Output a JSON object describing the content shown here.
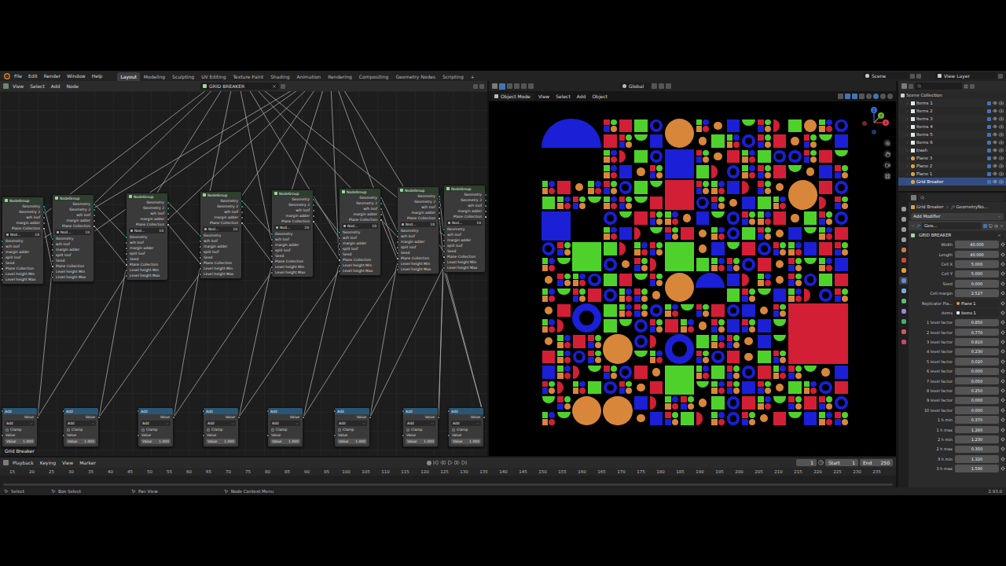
{
  "top_bar": {
    "menus": [
      "File",
      "Edit",
      "Render",
      "Window",
      "Help"
    ],
    "workspaces": [
      {
        "label": "Layout",
        "selected": true
      },
      {
        "label": "Modeling",
        "selected": false
      },
      {
        "label": "Sculpting",
        "selected": false
      },
      {
        "label": "UV Editing",
        "selected": false
      },
      {
        "label": "Texture Paint",
        "selected": false
      },
      {
        "label": "Shading",
        "selected": false
      },
      {
        "label": "Animation",
        "selected": false
      },
      {
        "label": "Rendering",
        "selected": false
      },
      {
        "label": "Compositing",
        "selected": false
      },
      {
        "label": "Geometry Nodes",
        "selected": false
      },
      {
        "label": "Scripting",
        "selected": false
      }
    ],
    "add_workspace": "+",
    "scene": "Scene",
    "view_layer": "View Layer"
  },
  "node_editor": {
    "menus": [
      "View",
      "Select",
      "Add",
      "Node"
    ],
    "node_tree": "GRID BREAKER",
    "tree_label": "Grid Breaker",
    "group_outputs": [
      {
        "label": "Geometry",
        "kind": "geometry"
      },
      {
        "label": "Geometry 2",
        "kind": "geometry"
      },
      {
        "label": "w/h loof",
        "kind": "value"
      },
      {
        "label": "margin adder",
        "kind": "value"
      },
      {
        "label": "Plane Collection",
        "kind": "collection"
      }
    ],
    "group_inputs": [
      {
        "label": "Geometry",
        "kind": "geometry"
      },
      {
        "label": "w/h loof",
        "kind": "value"
      },
      {
        "label": "margin adder",
        "kind": "value"
      },
      {
        "label": "split loof",
        "kind": "value"
      },
      {
        "label": "Seed",
        "kind": "value"
      },
      {
        "label": "Plane Collection",
        "kind": "collection"
      },
      {
        "label": "Level height Min",
        "kind": "value"
      },
      {
        "label": "Level height Max",
        "kind": "value"
      }
    ],
    "group_nodes": [
      {
        "title": "NodeGroup",
        "group": "Nod...",
        "users": "10"
      },
      {
        "title": "NodeGroup",
        "group": "Nod...",
        "users": "10"
      },
      {
        "title": "NodeGroup",
        "group": "Nod...",
        "users": "10"
      },
      {
        "title": "NodeGroup",
        "group": "Nod...",
        "users": "10"
      },
      {
        "title": "NodeGroup",
        "group": "Nod...",
        "users": "10"
      },
      {
        "title": "NodeGroup",
        "group": "Nod...",
        "users": "10"
      },
      {
        "title": "NodeGroup",
        "group": "Nod...",
        "users": "10"
      },
      {
        "title": "NodeGroup",
        "group": "Nod...",
        "users": "10"
      }
    ],
    "math_nodes": [
      {
        "title": "Add",
        "output": "Value",
        "operation": "Add",
        "clamp": "Clamp",
        "clamped": false,
        "input": "Value",
        "field_label": "Value",
        "value": "1.000"
      },
      {
        "title": "Add",
        "output": "Value",
        "operation": "Add",
        "clamp": "Clamp",
        "clamped": false,
        "input": "Value",
        "field_label": "Value",
        "value": "1.000"
      },
      {
        "title": "Add",
        "output": "Value",
        "operation": "Add",
        "clamp": "Clamp",
        "clamped": false,
        "input": "Value",
        "field_label": "Value",
        "value": "1.000"
      },
      {
        "title": "Add",
        "output": "Value",
        "operation": "Add",
        "clamp": "Clamp",
        "clamped": false,
        "input": "Value",
        "field_label": "Value",
        "value": "1.000"
      },
      {
        "title": "Add",
        "output": "Value",
        "operation": "Add",
        "clamp": "Clamp",
        "clamped": false,
        "input": "Value",
        "field_label": "Value",
        "value": "1.000"
      },
      {
        "title": "Add",
        "output": "Value",
        "operation": "Add",
        "clamp": "Clamp",
        "clamped": false,
        "input": "Value",
        "field_label": "Value",
        "value": "1.000"
      },
      {
        "title": "Add",
        "output": "Value",
        "operation": "Add",
        "clamp": "Clamp",
        "clamped": false,
        "input": "Value",
        "field_label": "Value",
        "value": "1.000"
      },
      {
        "title": "Add",
        "output": "Value",
        "operation": "Add",
        "clamp": "Clamp",
        "clamped": false,
        "input": "Value",
        "field_label": "Value",
        "value": "1.000"
      }
    ]
  },
  "viewport": {
    "mode": "Object Mode",
    "menus": [
      "View",
      "Select",
      "Add",
      "Object"
    ],
    "orientation": "Global",
    "axes": [
      {
        "label": "Z",
        "color": "#2f6fe0"
      },
      {
        "label": "Y",
        "color": "#6fb52a"
      },
      {
        "label": "X",
        "color": "#e0394f"
      }
    ],
    "legend": {
      "R": {
        "kind": "square",
        "color": "#d21f35"
      },
      "G": {
        "kind": "square",
        "color": "#4ed22b"
      },
      "B": {
        "kind": "square",
        "color": "#1b1fd6"
      },
      "O": {
        "kind": "circle",
        "color": "#d8863a"
      },
      "o": {
        "kind": "dot",
        "color": "#d8863a"
      },
      "r": {
        "kind": "half-right",
        "color": "#d21f35"
      },
      "g": {
        "kind": "half-bottom",
        "color": "#4ed22b"
      },
      "b": {
        "kind": "ring",
        "color": "#1b1fd6"
      },
      "Q": {
        "kind": "quad",
        "colors": [
          "#d21f35",
          "#4ed22b",
          "#1b1fd6",
          "#d8863a"
        ]
      },
      "P": {
        "kind": "quad",
        "colors": [
          "#4ed22b",
          "#1b1fd6",
          "#d8863a",
          "#d21f35"
        ]
      }
    },
    "shapes": [
      {
        "kind": "dome",
        "color": "#1b1fd6",
        "col": 0,
        "row": 0,
        "span_cols": 4,
        "span_rows": 2
      },
      {
        "kind": "blank",
        "col": 0,
        "row": 2,
        "span_cols": 4,
        "span_rows": 2
      },
      {
        "kind": "circle",
        "color": "#d8863a",
        "col": 8,
        "row": 0,
        "span_cols": 2,
        "span_rows": 2
      },
      {
        "kind": "square",
        "color": "#1b1fd6",
        "col": 8,
        "row": 2,
        "span_cols": 2,
        "span_rows": 2
      },
      {
        "kind": "square",
        "color": "#d21f35",
        "col": 8,
        "row": 4,
        "span_cols": 2,
        "span_rows": 2
      },
      {
        "kind": "circle",
        "color": "#d8863a",
        "col": 16,
        "row": 4,
        "span_cols": 2,
        "span_rows": 2
      },
      {
        "kind": "square",
        "color": "#1b1fd6",
        "col": 0,
        "row": 6,
        "span_cols": 2,
        "span_rows": 2
      },
      {
        "kind": "blank",
        "col": 2,
        "row": 6,
        "span_cols": 2,
        "span_rows": 2
      },
      {
        "kind": "square",
        "color": "#4ed22b",
        "col": 2,
        "row": 8,
        "span_cols": 2,
        "span_rows": 2
      },
      {
        "kind": "square",
        "color": "#4ed22b",
        "col": 8,
        "row": 8,
        "span_cols": 2,
        "span_rows": 2
      },
      {
        "kind": "circle",
        "color": "#d8863a",
        "col": 8,
        "row": 10,
        "span_cols": 2,
        "span_rows": 2
      },
      {
        "kind": "half-top",
        "color": "#1b1fd6",
        "col": 10,
        "row": 10,
        "span_cols": 2,
        "span_rows": 2
      },
      {
        "kind": "ring",
        "color": "#1b1fd6",
        "col": 2,
        "row": 12,
        "span_cols": 2,
        "span_rows": 2
      },
      {
        "kind": "square",
        "color": "#d21f35",
        "col": 16,
        "row": 12,
        "span_cols": 4,
        "span_rows": 4
      },
      {
        "kind": "circle",
        "color": "#d8863a",
        "col": 4,
        "row": 14,
        "span_cols": 2,
        "span_rows": 2
      },
      {
        "kind": "ring",
        "color": "#1b1fd6",
        "col": 8,
        "row": 14,
        "span_cols": 2,
        "span_rows": 2
      },
      {
        "kind": "square",
        "color": "#4ed22b",
        "col": 8,
        "row": 16,
        "span_cols": 2,
        "span_rows": 2
      },
      {
        "kind": "circle",
        "color": "#d8863a",
        "col": 2,
        "row": 18,
        "span_cols": 2,
        "span_rows": 2
      },
      {
        "kind": "circle",
        "color": "#d8863a",
        "col": 4,
        "row": 18,
        "span_cols": 2,
        "span_rows": 2
      }
    ],
    "cells": [
      "QRGbPoBgQrGOPbRQgBo",
      "GPbQRoQgBPrGbQoRPGb",
      "bQRgPBoQGrbPQRgoBQP",
      "RoPQbGgQPBrQoRbGPQg",
      "PQgRbQoBGPrQbgRQPoB",
      "gbQPRoGQbPBrgQRoPbG",
      "QoBgPRbQGrPQoBgRbQP",
      "BRQPgboQrGPQbRoQgPB",
      "oQPbGRgQBrPoQbGRPgQ",
      "RbPQoGQgBPrbQoRGPQb",
      "PgQRbBoQPrGgbQRPoQB",
      "QBgoPRQbrGPQoBgRPbQ",
      "gPQbRoGQBPrgQbRoPGQ",
      "bRPQgoBQrPGbQoRgPQB",
      "QoGPbRgQBrPQoGbRPgQ",
      "RQbPgoBQGrPbQoRgBPQ"
    ]
  },
  "timeline": {
    "menus": [
      "Playback",
      "Keying",
      "View",
      "Marker"
    ],
    "current_frame": "1",
    "start_label": "Start",
    "start": "1",
    "end_label": "End",
    "end": "250",
    "ruler": [
      "15",
      "20",
      "25",
      "30",
      "35",
      "40",
      "45",
      "50",
      "55",
      "60",
      "65",
      "70",
      "75",
      "80",
      "85",
      "90",
      "95",
      "100",
      "105",
      "110",
      "115",
      "120",
      "125",
      "130",
      "135",
      "140",
      "145",
      "150",
      "155",
      "160",
      "165",
      "170",
      "175",
      "180",
      "185",
      "190",
      "195",
      "200",
      "205",
      "210",
      "215",
      "220",
      "225",
      "230",
      "235"
    ]
  },
  "outliner": {
    "root": "Scene Collection",
    "items": [
      {
        "label": "Items 1",
        "kind": "collection",
        "visible": true,
        "selected": false
      },
      {
        "label": "Items 2",
        "kind": "collection",
        "visible": true,
        "selected": false
      },
      {
        "label": "Items 3",
        "kind": "collection",
        "visible": true,
        "selected": false
      },
      {
        "label": "Items 4",
        "kind": "collection",
        "visible": true,
        "selected": false
      },
      {
        "label": "Items 5",
        "kind": "collection",
        "visible": true,
        "selected": false
      },
      {
        "label": "Items 6",
        "kind": "collection",
        "visible": true,
        "selected": false
      },
      {
        "label": "trash",
        "kind": "collection",
        "visible": true,
        "selected": false
      },
      {
        "label": "Plane 3",
        "kind": "object",
        "visible": true,
        "selected": false
      },
      {
        "label": "Plane 2",
        "kind": "object",
        "visible": true,
        "selected": false
      },
      {
        "label": "Plane 1",
        "kind": "object",
        "visible": true,
        "selected": false
      },
      {
        "label": "Grid Breaker",
        "kind": "object",
        "visible": true,
        "selected": true
      }
    ]
  },
  "properties": {
    "tabs": [
      {
        "color": "#9a9a9a",
        "selected": false
      },
      {
        "color": "#9a9a9a",
        "selected": false
      },
      {
        "color": "#9a9a9a",
        "selected": false
      },
      {
        "color": "#9a9a9a",
        "selected": false
      },
      {
        "color": "#c77b46",
        "selected": false
      },
      {
        "color": "#d0483a",
        "selected": false
      },
      {
        "color": "#e39b3c",
        "selected": false
      },
      {
        "color": "#5a8fe0",
        "selected": true
      },
      {
        "color": "#7fa7e8",
        "selected": false
      },
      {
        "color": "#5fbf6f",
        "selected": false
      },
      {
        "color": "#9a86d8",
        "selected": false
      },
      {
        "color": "#46b06a",
        "selected": false
      },
      {
        "color": "#d05a5a",
        "selected": false
      },
      {
        "color": "#c84a6a",
        "selected": false
      }
    ],
    "object": "Grid Breaker",
    "modifier_crumb": "GeometryNo...",
    "add_modifier": "Add Modifier",
    "modifier_name": "Geo...",
    "node_group": "GRID BREAKER",
    "fields": [
      {
        "label": "Width",
        "value": "40.000",
        "kind": "number"
      },
      {
        "label": "Length",
        "value": "40.000",
        "kind": "number"
      },
      {
        "label": "Cell X",
        "value": "5.000",
        "kind": "number"
      },
      {
        "label": "Cell Y",
        "value": "5.000",
        "kind": "number"
      },
      {
        "label": "Seed",
        "value": "0.000",
        "kind": "number"
      },
      {
        "label": "Cell margin",
        "value": "2.527",
        "kind": "number"
      },
      {
        "label": "Replicator Pla...",
        "value": "Plane 1",
        "kind": "object"
      },
      {
        "label": "Items",
        "value": "Items 1",
        "kind": "collection"
      },
      {
        "label": "1 level factor",
        "value": "0.850",
        "kind": "number"
      },
      {
        "label": "2 level factor",
        "value": "0.770",
        "kind": "number"
      },
      {
        "label": "3 level factor",
        "value": "0.810",
        "kind": "number"
      },
      {
        "label": "4 level factor",
        "value": "0.230",
        "kind": "number"
      },
      {
        "label": "5 level factor",
        "value": "0.020",
        "kind": "number"
      },
      {
        "label": "6 level factor",
        "value": "0.000",
        "kind": "number"
      },
      {
        "label": "7 level factor",
        "value": "0.050",
        "kind": "number"
      },
      {
        "label": "8 level factor",
        "value": "0.250",
        "kind": "number"
      },
      {
        "label": "9 level factor",
        "value": "0.000",
        "kind": "number"
      },
      {
        "label": "10 level factor",
        "value": "0.000",
        "kind": "number"
      },
      {
        "label": "1 h min",
        "value": "0.370",
        "kind": "number"
      },
      {
        "label": "1 h max",
        "value": "1.260",
        "kind": "number"
      },
      {
        "label": "2 h min",
        "value": "1.230",
        "kind": "number"
      },
      {
        "label": "2 h max",
        "value": "0.350",
        "kind": "number"
      },
      {
        "label": "3 h min",
        "value": "1.320",
        "kind": "number"
      },
      {
        "label": "3 h max",
        "value": "1.590",
        "kind": "number"
      }
    ]
  },
  "status_bar": {
    "hints": [
      "Select",
      "Box Select",
      "Pan View",
      "Node Context Menu"
    ],
    "version": "2.93.0"
  }
}
